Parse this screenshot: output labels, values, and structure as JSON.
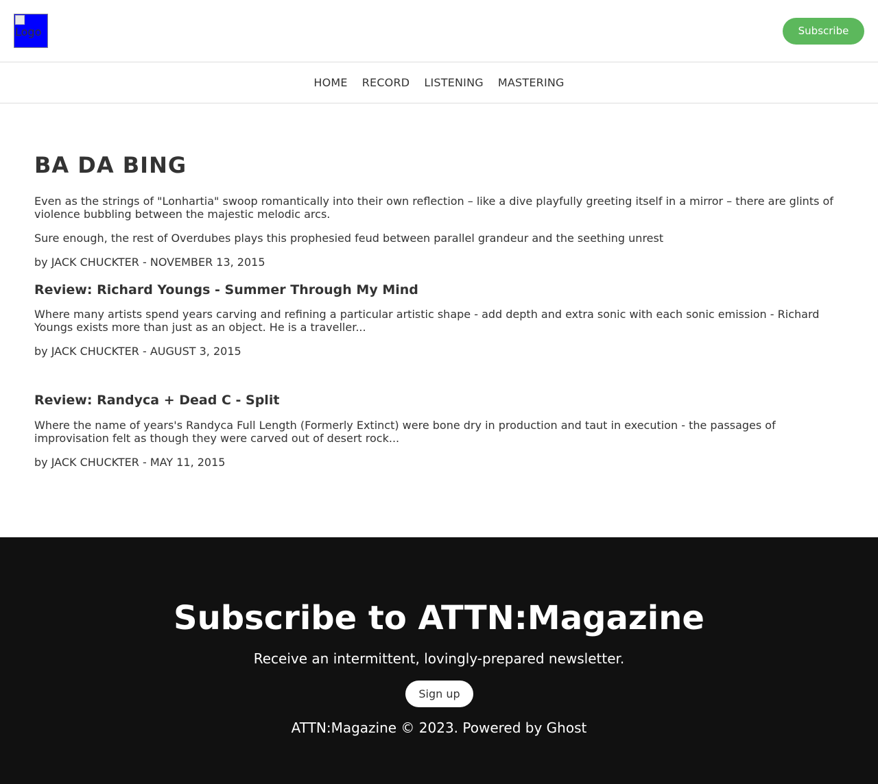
{
  "header": {
    "logo_alt": "Logo",
    "subscribe_label": "Subscribe"
  },
  "nav": {
    "items": [
      {
        "label": "HOME"
      },
      {
        "label": "RECORD"
      },
      {
        "label": "LISTENING"
      },
      {
        "label": "MASTERING"
      }
    ]
  },
  "main": {
    "title": "BA DA BING",
    "intro": [
      "Even as the strings of \"Lonhartia\" swoop romantically into their own reflection – like a dive playfully greeting itself in a mirror – there are glints of violence bubbling between the majestic melodic arcs.",
      "Sure enough, the rest of Overdubes plays this prophesied feud between parallel grandeur and the seething unrest"
    ],
    "intro_byline": "by JACK CHUCKTER - NOVEMBER 13, 2015",
    "posts": [
      {
        "title": "Review: Richard Youngs - Summer Through My Mind",
        "excerpt": "Where many artists spend years carving and refining a particular artistic shape - add depth and extra sonic with each sonic emission - Richard Youngs exists more than just as an object. He is a traveller...",
        "byline": "by JACK CHUCKTER - AUGUST 3, 2015"
      },
      {
        "title": "Review: Randyca + Dead C - Split",
        "excerpt": "Where the name of years's Randyca Full Length (Formerly Extinct) were bone dry in production and taut in execution - the passages of improvisation felt as though they were carved out of desert rock...",
        "byline": "by JACK CHUCKTER - MAY 11, 2015"
      }
    ]
  },
  "footer": {
    "heading": "Subscribe to ATTN:Magazine",
    "tagline": "Receive an intermittent, lovingly-prepared newsletter.",
    "signup_label": "Sign up",
    "copyright": "ATTN:Magazine © 2023. Powered by Ghost"
  },
  "colors": {
    "accent": "#5cb85c",
    "footer_bg": "#111111",
    "text": "#333333",
    "logo_bg": "#0000ff"
  }
}
